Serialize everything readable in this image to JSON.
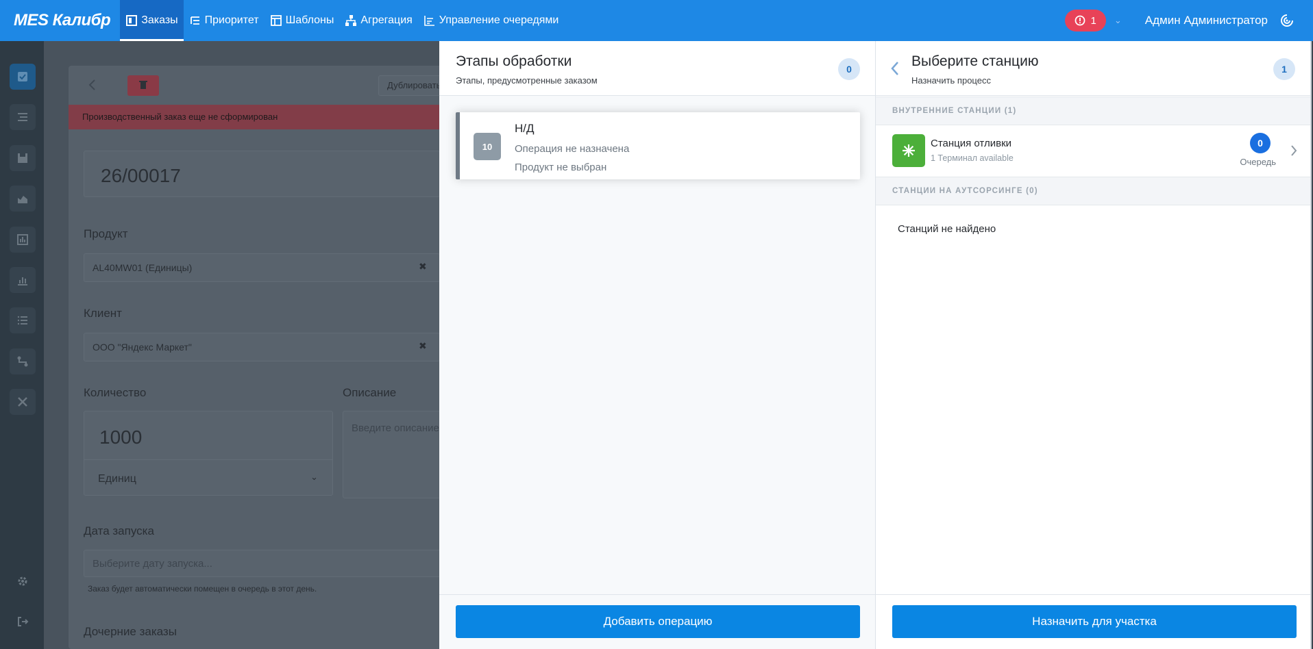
{
  "app": {
    "brand": "MES Калибр"
  },
  "nav": {
    "items": [
      {
        "label": "Заказы",
        "icon": "board-icon",
        "active": true
      },
      {
        "label": "Приоритет",
        "icon": "priority-icon"
      },
      {
        "label": "Шаблоны",
        "icon": "template-icon"
      },
      {
        "label": "Агрегация",
        "icon": "aggregation-icon"
      },
      {
        "label": "Управление очередями",
        "icon": "queue-management-icon"
      }
    ],
    "alert_count": "1",
    "user_name": "Админ Администратор"
  },
  "background_form": {
    "banner": "Производственный заказ еще не сформирован",
    "duplicate_label": "Дублировать",
    "order_number": "26/00017",
    "product_label": "Продукт",
    "product_value": "AL40MW01 (Единицы)",
    "client_label": "Клиент",
    "client_value": "ООО \"Яндекс Маркет\"",
    "quantity_label": "Количество",
    "quantity_value": "1000",
    "unit_value": "Единиц",
    "description_label": "Описание",
    "description_placeholder": "Введите описание",
    "launch_date_label": "Дата запуска",
    "launch_date_placeholder": "Выберите дату запуска...",
    "launch_date_hint": "Заказ будет автоматически помещен в очередь в этот день.",
    "child_orders_label": "Дочерние заказы"
  },
  "stages_panel": {
    "title": "Этапы обработки",
    "subtitle": "Этапы, предусмотренные заказом",
    "count": "0",
    "operations": [
      {
        "number": "10",
        "title": "Н/Д",
        "operation_text": "Операция не назначена",
        "product_text": "Продукт не выбран"
      }
    ],
    "add_button": "Добавить операцию"
  },
  "station_panel": {
    "title": "Выберите станцию",
    "subtitle": "Назначить процесс",
    "count": "1",
    "internal_header": "ВНУТРЕННИЕ СТАНЦИИ (1)",
    "stations": [
      {
        "name": "Станция отливки",
        "terminals": "1 Терминал available",
        "queue_count": "0",
        "queue_label": "Очередь",
        "color": "#4caf3a"
      }
    ],
    "outsourced_header": "СТАНЦИИ НА АУТСОРСИНГЕ (0)",
    "outsourced_empty": "Станций не найдено",
    "assign_button": "Назначить для участка"
  },
  "colors": {
    "navbar": "#1e88e5",
    "primary_button": "#0a86e3",
    "alert": "#e84258",
    "station": "#4caf3a"
  }
}
